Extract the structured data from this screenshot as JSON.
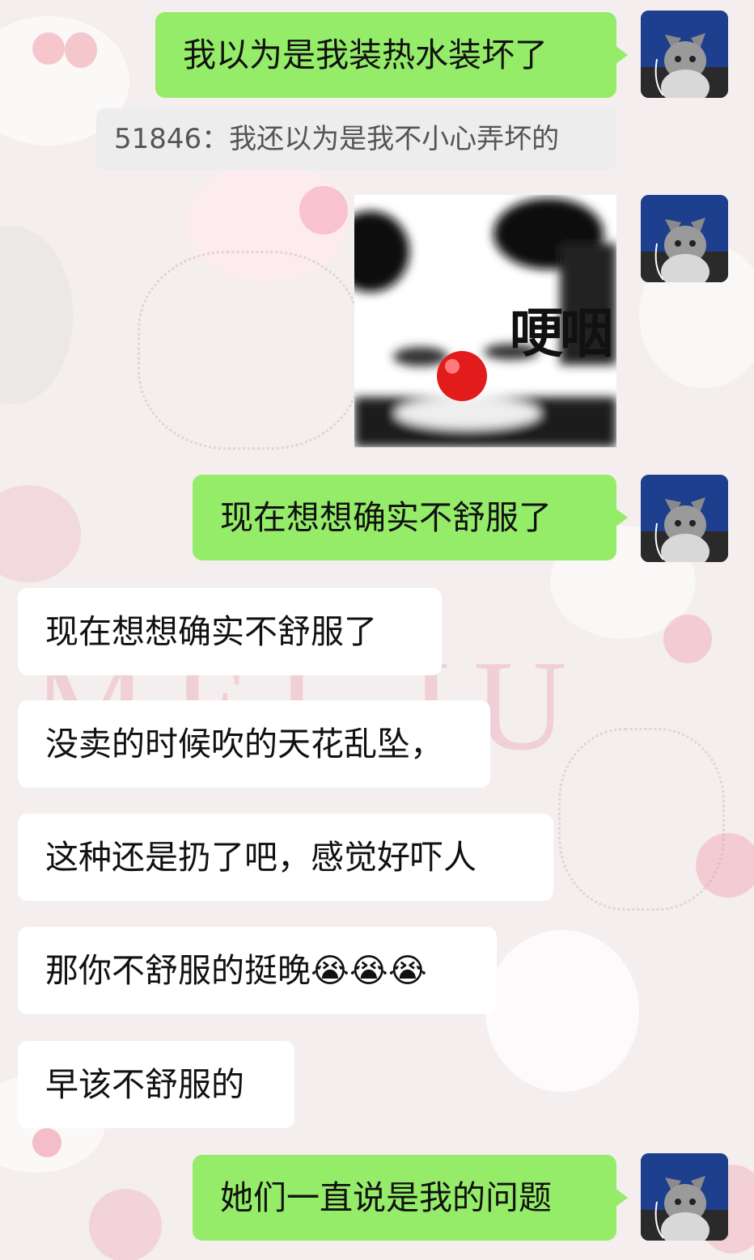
{
  "messages": {
    "m1": "我以为是我装热水装坏了",
    "quote": "51846：我还以为是我不小心弄坏的",
    "sticker_caption": "哽咽",
    "m2": "现在想想确实不舒服了",
    "in1": "现在想想确实不舒服了",
    "in2": "没卖的时候吹的天花乱坠，",
    "in3": "这种还是扔了吧，感觉好吓人",
    "in4": "那你不舒服的挺晚😭😭😭",
    "in5": "早该不舒服的",
    "m3": "她们一直说是我的问题"
  },
  "avatar": {
    "icon": "cat-avatar-icon"
  },
  "colors": {
    "outgoing_bubble": "#95ec69",
    "incoming_bubble": "#ffffff",
    "quote_bg": "#ececec"
  },
  "wallpaper": {
    "watermark": "MEI JU"
  }
}
